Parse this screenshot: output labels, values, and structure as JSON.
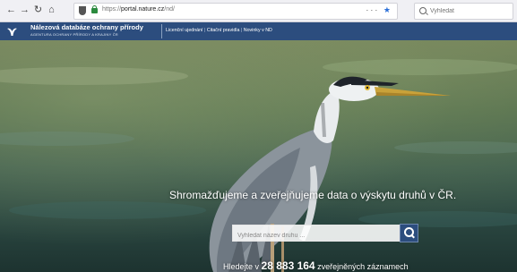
{
  "browser": {
    "url_protocol": "https://",
    "url_host": "portal.nature.cz",
    "url_path": "/nd/",
    "search_placeholder": "Vyhledat",
    "url_icons": "··· ",
    "star_glyph": "★"
  },
  "site": {
    "title": "Nálezová databáze ochrany přírody",
    "subtitle": "AGENTURA OCHRANY PŘÍRODY A KRAJINY ČR",
    "nav": [
      "Licenční ujednání",
      "Citační pravidla",
      "Novinky v ND"
    ],
    "nav_separator": "|"
  },
  "hero": {
    "tagline": "Shromažďujeme a zveřejňujeme data o výskytu druhů v ČR.",
    "search_placeholder": "Vyhledat název druhu ...",
    "stats_prefix": "Hledejte v",
    "stats_count": "28 883 164",
    "stats_suffix": "zveřejněných záznamech"
  },
  "icons": {
    "back": "back-arrow-icon",
    "forward": "forward-arrow-icon",
    "reload": "reload-icon",
    "home": "home-icon",
    "search": "magnifier-icon",
    "logo": "bird-logo-icon"
  },
  "colors": {
    "header_blue": "#2c4d7e",
    "toolbar": "#f0f0f4"
  }
}
